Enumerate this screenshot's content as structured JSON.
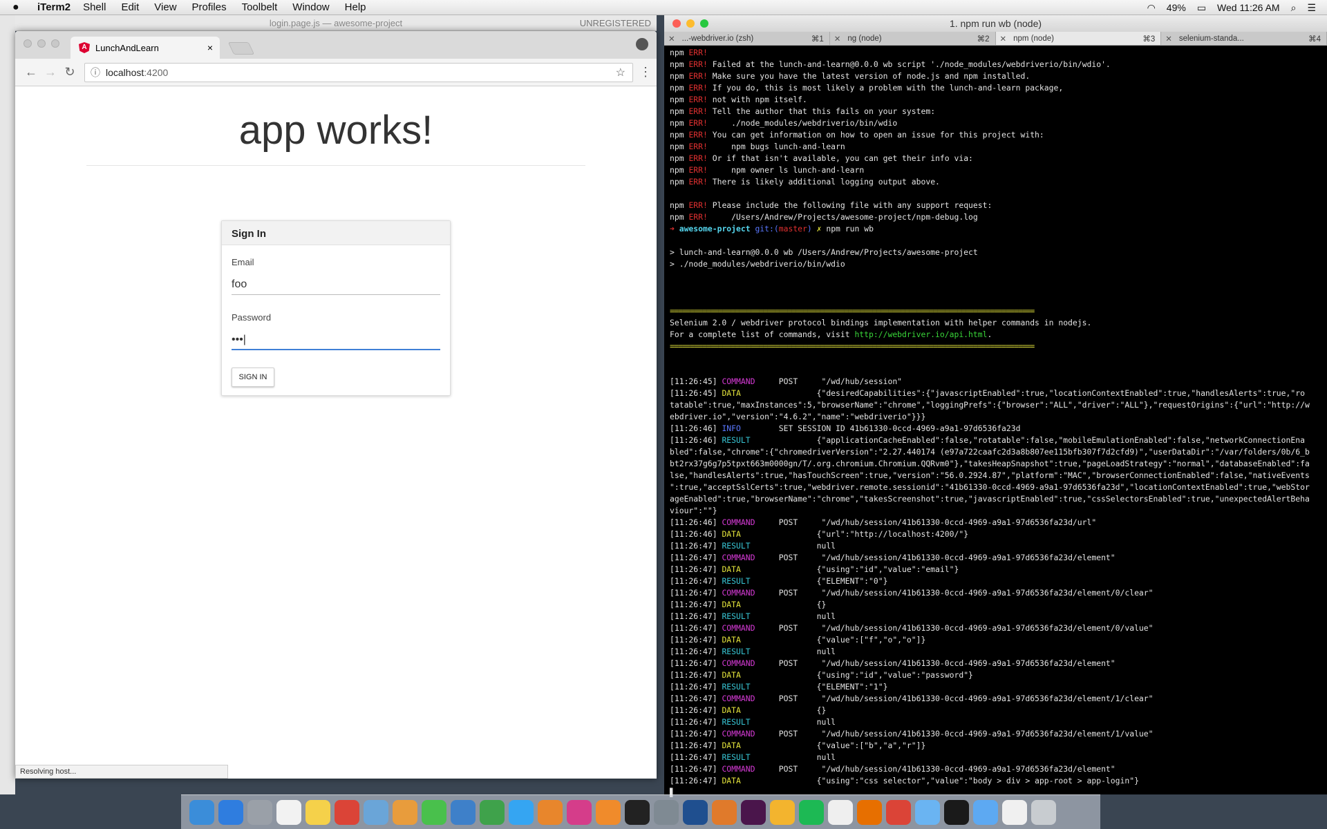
{
  "menubar": {
    "apple": "",
    "app": "iTerm2",
    "items": [
      "Shell",
      "Edit",
      "View",
      "Profiles",
      "Toolbelt",
      "Window",
      "Help"
    ],
    "battery": "49%",
    "clock": "Wed 11:26 AM"
  },
  "atom": {
    "title": "login.page.js — awesome-project",
    "badge": "UNREGISTERED"
  },
  "browser": {
    "tab_title": "LunchAndLearn",
    "tab_close": "×",
    "url_host": "localhost",
    "url_port": ":4200",
    "page_heading": "app works!",
    "card_title": "Sign In",
    "email_label": "Email",
    "email_value": "foo",
    "password_label": "Password",
    "password_value": "•••|",
    "signin_button": "SIGN IN",
    "status": "Resolving host..."
  },
  "iterm": {
    "title": "1. npm run wb (node)",
    "tabs": [
      {
        "label": "...-webdriver.io (zsh)",
        "key": "⌘1"
      },
      {
        "label": "ng (node)",
        "key": "⌘2"
      },
      {
        "label": "npm (node)",
        "key": "⌘3"
      },
      {
        "label": "selenium-standa...",
        "key": "⌘4"
      }
    ],
    "lines": [
      [
        [
          "npm ",
          ""
        ],
        [
          "ERR!",
          "c-red"
        ]
      ],
      [
        [
          "npm ",
          ""
        ],
        [
          "ERR!",
          "c-red"
        ],
        [
          " Failed at the lunch-and-learn@0.0.0 wb script './node_modules/webdriverio/bin/wdio'.",
          ""
        ]
      ],
      [
        [
          "npm ",
          ""
        ],
        [
          "ERR!",
          "c-red"
        ],
        [
          " Make sure you have the latest version of node.js and npm installed.",
          ""
        ]
      ],
      [
        [
          "npm ",
          ""
        ],
        [
          "ERR!",
          "c-red"
        ],
        [
          " If you do, this is most likely a problem with the lunch-and-learn package,",
          ""
        ]
      ],
      [
        [
          "npm ",
          ""
        ],
        [
          "ERR!",
          "c-red"
        ],
        [
          " not with npm itself.",
          ""
        ]
      ],
      [
        [
          "npm ",
          ""
        ],
        [
          "ERR!",
          "c-red"
        ],
        [
          " Tell the author that this fails on your system:",
          ""
        ]
      ],
      [
        [
          "npm ",
          ""
        ],
        [
          "ERR!",
          "c-red"
        ],
        [
          "     ./node_modules/webdriverio/bin/wdio",
          ""
        ]
      ],
      [
        [
          "npm ",
          ""
        ],
        [
          "ERR!",
          "c-red"
        ],
        [
          " You can get information on how to open an issue for this project with:",
          ""
        ]
      ],
      [
        [
          "npm ",
          ""
        ],
        [
          "ERR!",
          "c-red"
        ],
        [
          "     npm bugs lunch-and-learn",
          ""
        ]
      ],
      [
        [
          "npm ",
          ""
        ],
        [
          "ERR!",
          "c-red"
        ],
        [
          " Or if that isn't available, you can get their info via:",
          ""
        ]
      ],
      [
        [
          "npm ",
          ""
        ],
        [
          "ERR!",
          "c-red"
        ],
        [
          "     npm owner ls lunch-and-learn",
          ""
        ]
      ],
      [
        [
          "npm ",
          ""
        ],
        [
          "ERR!",
          "c-red"
        ],
        [
          " There is likely additional logging output above.",
          ""
        ]
      ],
      [
        [
          "",
          ""
        ]
      ],
      [
        [
          "npm ",
          ""
        ],
        [
          "ERR!",
          "c-red"
        ],
        [
          " Please include the following file with any support request:",
          ""
        ]
      ],
      [
        [
          "npm ",
          ""
        ],
        [
          "ERR!",
          "c-red"
        ],
        [
          "     /Users/Andrew/Projects/awesome-project/npm-debug.log",
          ""
        ]
      ],
      [
        [
          "➜ ",
          "c-red"
        ],
        [
          "awesome-project ",
          "c-bcyan"
        ],
        [
          "git:(",
          "c-blu"
        ],
        [
          "master",
          "c-red"
        ],
        [
          ")",
          "c-blu"
        ],
        [
          " ✗ ",
          "c-yel"
        ],
        [
          "npm run wb",
          ""
        ]
      ],
      [
        [
          "",
          ""
        ]
      ],
      [
        [
          "> lunch-and-learn@0.0.0 wb /Users/Andrew/Projects/awesome-project",
          ""
        ]
      ],
      [
        [
          "> ./node_modules/webdriverio/bin/wdio",
          ""
        ]
      ],
      [
        [
          "",
          ""
        ]
      ],
      [
        [
          "",
          ""
        ]
      ],
      [
        [
          "",
          ""
        ]
      ],
      [
        [
          "==========================================================================================",
          "sep"
        ]
      ],
      [
        [
          "Selenium 2.0 / webdriver protocol bindings implementation with helper commands in nodejs.",
          ""
        ]
      ],
      [
        [
          "For a complete list of commands, visit ",
          ""
        ],
        [
          "http://webdriver.io/api.html",
          "c-grn"
        ],
        [
          ".",
          ""
        ]
      ],
      [
        [
          "==========================================================================================",
          "sep"
        ]
      ],
      [
        [
          "",
          ""
        ]
      ],
      [
        [
          "",
          ""
        ]
      ],
      [
        [
          "[11:26:45] ",
          ""
        ],
        [
          "COMMAND",
          "c-mag"
        ],
        [
          "     POST     \"/wd/hub/session\"",
          ""
        ]
      ],
      [
        [
          "[11:26:45] ",
          ""
        ],
        [
          "DATA",
          "c-yel"
        ],
        [
          "                {\"desiredCapabilities\":{\"javascriptEnabled\":true,\"locationContextEnabled\":true,\"handlesAlerts\":true,\"ro",
          ""
        ]
      ],
      [
        [
          "tatable\":true,\"maxInstances\":5,\"browserName\":\"chrome\",\"loggingPrefs\":{\"browser\":\"ALL\",\"driver\":\"ALL\"},\"requestOrigins\":{\"url\":\"http://w",
          ""
        ]
      ],
      [
        [
          "ebdriver.io\",\"version\":\"4.6.2\",\"name\":\"webdriverio\"}}}",
          ""
        ]
      ],
      [
        [
          "[11:26:46] ",
          ""
        ],
        [
          "INFO",
          "c-blu"
        ],
        [
          "        SET SESSION ID 41b61330-0ccd-4969-a9a1-97d6536fa23d",
          ""
        ]
      ],
      [
        [
          "[11:26:46] ",
          ""
        ],
        [
          "RESULT",
          "c-cyn"
        ],
        [
          "              {\"applicationCacheEnabled\":false,\"rotatable\":false,\"mobileEmulationEnabled\":false,\"networkConnectionEna",
          ""
        ]
      ],
      [
        [
          "bled\":false,\"chrome\":{\"chromedriverVersion\":\"2.27.440174 (e97a722caafc2d3a8b807ee115bfb307f7d2cfd9)\",\"userDataDir\":\"/var/folders/0b/6_b",
          ""
        ]
      ],
      [
        [
          "bt2rx37g6g7p5tpxt663m0000gn/T/.org.chromium.Chromium.QQRvm0\"},\"takesHeapSnapshot\":true,\"pageLoadStrategy\":\"normal\",\"databaseEnabled\":fa",
          ""
        ]
      ],
      [
        [
          "lse,\"handlesAlerts\":true,\"hasTouchScreen\":true,\"version\":\"56.0.2924.87\",\"platform\":\"MAC\",\"browserConnectionEnabled\":false,\"nativeEvents",
          ""
        ]
      ],
      [
        [
          "\":true,\"acceptSslCerts\":true,\"webdriver.remote.sessionid\":\"41b61330-0ccd-4969-a9a1-97d6536fa23d\",\"locationContextEnabled\":true,\"webStor",
          ""
        ]
      ],
      [
        [
          "ageEnabled\":true,\"browserName\":\"chrome\",\"takesScreenshot\":true,\"javascriptEnabled\":true,\"cssSelectorsEnabled\":true,\"unexpectedAlertBeha",
          ""
        ]
      ],
      [
        [
          "viour\":\"\"}",
          ""
        ]
      ],
      [
        [
          "[11:26:46] ",
          ""
        ],
        [
          "COMMAND",
          "c-mag"
        ],
        [
          "     POST     \"/wd/hub/session/41b61330-0ccd-4969-a9a1-97d6536fa23d/url\"",
          ""
        ]
      ],
      [
        [
          "[11:26:46] ",
          ""
        ],
        [
          "DATA",
          "c-yel"
        ],
        [
          "                {\"url\":\"http://localhost:4200/\"}",
          ""
        ]
      ],
      [
        [
          "[11:26:47] ",
          ""
        ],
        [
          "RESULT",
          "c-cyn"
        ],
        [
          "              null",
          ""
        ]
      ],
      [
        [
          "[11:26:47] ",
          ""
        ],
        [
          "COMMAND",
          "c-mag"
        ],
        [
          "     POST     \"/wd/hub/session/41b61330-0ccd-4969-a9a1-97d6536fa23d/element\"",
          ""
        ]
      ],
      [
        [
          "[11:26:47] ",
          ""
        ],
        [
          "DATA",
          "c-yel"
        ],
        [
          "                {\"using\":\"id\",\"value\":\"email\"}",
          ""
        ]
      ],
      [
        [
          "[11:26:47] ",
          ""
        ],
        [
          "RESULT",
          "c-cyn"
        ],
        [
          "              {\"ELEMENT\":\"0\"}",
          ""
        ]
      ],
      [
        [
          "[11:26:47] ",
          ""
        ],
        [
          "COMMAND",
          "c-mag"
        ],
        [
          "     POST     \"/wd/hub/session/41b61330-0ccd-4969-a9a1-97d6536fa23d/element/0/clear\"",
          ""
        ]
      ],
      [
        [
          "[11:26:47] ",
          ""
        ],
        [
          "DATA",
          "c-yel"
        ],
        [
          "                {}",
          ""
        ]
      ],
      [
        [
          "[11:26:47] ",
          ""
        ],
        [
          "RESULT",
          "c-cyn"
        ],
        [
          "              null",
          ""
        ]
      ],
      [
        [
          "[11:26:47] ",
          ""
        ],
        [
          "COMMAND",
          "c-mag"
        ],
        [
          "     POST     \"/wd/hub/session/41b61330-0ccd-4969-a9a1-97d6536fa23d/element/0/value\"",
          ""
        ]
      ],
      [
        [
          "[11:26:47] ",
          ""
        ],
        [
          "DATA",
          "c-yel"
        ],
        [
          "                {\"value\":[\"f\",\"o\",\"o\"]}",
          ""
        ]
      ],
      [
        [
          "[11:26:47] ",
          ""
        ],
        [
          "RESULT",
          "c-cyn"
        ],
        [
          "              null",
          ""
        ]
      ],
      [
        [
          "[11:26:47] ",
          ""
        ],
        [
          "COMMAND",
          "c-mag"
        ],
        [
          "     POST     \"/wd/hub/session/41b61330-0ccd-4969-a9a1-97d6536fa23d/element\"",
          ""
        ]
      ],
      [
        [
          "[11:26:47] ",
          ""
        ],
        [
          "DATA",
          "c-yel"
        ],
        [
          "                {\"using\":\"id\",\"value\":\"password\"}",
          ""
        ]
      ],
      [
        [
          "[11:26:47] ",
          ""
        ],
        [
          "RESULT",
          "c-cyn"
        ],
        [
          "              {\"ELEMENT\":\"1\"}",
          ""
        ]
      ],
      [
        [
          "[11:26:47] ",
          ""
        ],
        [
          "COMMAND",
          "c-mag"
        ],
        [
          "     POST     \"/wd/hub/session/41b61330-0ccd-4969-a9a1-97d6536fa23d/element/1/clear\"",
          ""
        ]
      ],
      [
        [
          "[11:26:47] ",
          ""
        ],
        [
          "DATA",
          "c-yel"
        ],
        [
          "                {}",
          ""
        ]
      ],
      [
        [
          "[11:26:47] ",
          ""
        ],
        [
          "RESULT",
          "c-cyn"
        ],
        [
          "              null",
          ""
        ]
      ],
      [
        [
          "[11:26:47] ",
          ""
        ],
        [
          "COMMAND",
          "c-mag"
        ],
        [
          "     POST     \"/wd/hub/session/41b61330-0ccd-4969-a9a1-97d6536fa23d/element/1/value\"",
          ""
        ]
      ],
      [
        [
          "[11:26:47] ",
          ""
        ],
        [
          "DATA",
          "c-yel"
        ],
        [
          "                {\"value\":[\"b\",\"a\",\"r\"]}",
          ""
        ]
      ],
      [
        [
          "[11:26:47] ",
          ""
        ],
        [
          "RESULT",
          "c-cyn"
        ],
        [
          "              null",
          ""
        ]
      ],
      [
        [
          "[11:26:47] ",
          ""
        ],
        [
          "COMMAND",
          "c-mag"
        ],
        [
          "     POST     \"/wd/hub/session/41b61330-0ccd-4969-a9a1-97d6536fa23d/element\"",
          ""
        ]
      ],
      [
        [
          "[11:26:47] ",
          ""
        ],
        [
          "DATA",
          "c-yel"
        ],
        [
          "                {\"using\":\"css selector\",\"value\":\"body > div > app-root > app-login\"}",
          ""
        ]
      ],
      [
        [
          "▋",
          ""
        ]
      ]
    ]
  },
  "dock": {
    "icons": [
      "finder-icon",
      "safari-icon",
      "launchpad-icon",
      "calendar-icon",
      "notes-icon",
      "chrome-icon",
      "preview-icon",
      "photos-icon",
      "facetime-icon",
      "keynote-icon",
      "numbers-icon",
      "messages-icon",
      "ibooks-icon",
      "itunes-icon",
      "books-icon",
      "terminal-icon",
      "system-preferences-icon",
      "quicktime-icon",
      "sublime-icon",
      "slack-icon",
      "sketch-icon",
      "spotify-icon",
      "textedit-icon",
      "java-icon",
      "chrome-2-icon",
      "folder-icon",
      "iterm-icon",
      "downloads-icon",
      "documents-icon",
      "trash-icon"
    ],
    "colors": [
      "#3b8dd9",
      "#2f7ddf",
      "#9aa0a8",
      "#f2f2f2",
      "#f5d14a",
      "#db4437",
      "#6aa5d8",
      "#e89c3c",
      "#49c04c",
      "#3e80c9",
      "#3fa24b",
      "#35a5f2",
      "#e8862c",
      "#d53d8a",
      "#f08b2b",
      "#222222",
      "#7f8a93",
      "#1f4f8f",
      "#e07a2b",
      "#4a154b",
      "#f3b42e",
      "#1db954",
      "#efefef",
      "#e76f00",
      "#db4437",
      "#6ab4f2",
      "#1a1a1a",
      "#5da9f2",
      "#f0f0f0",
      "#c8ccd0"
    ]
  }
}
